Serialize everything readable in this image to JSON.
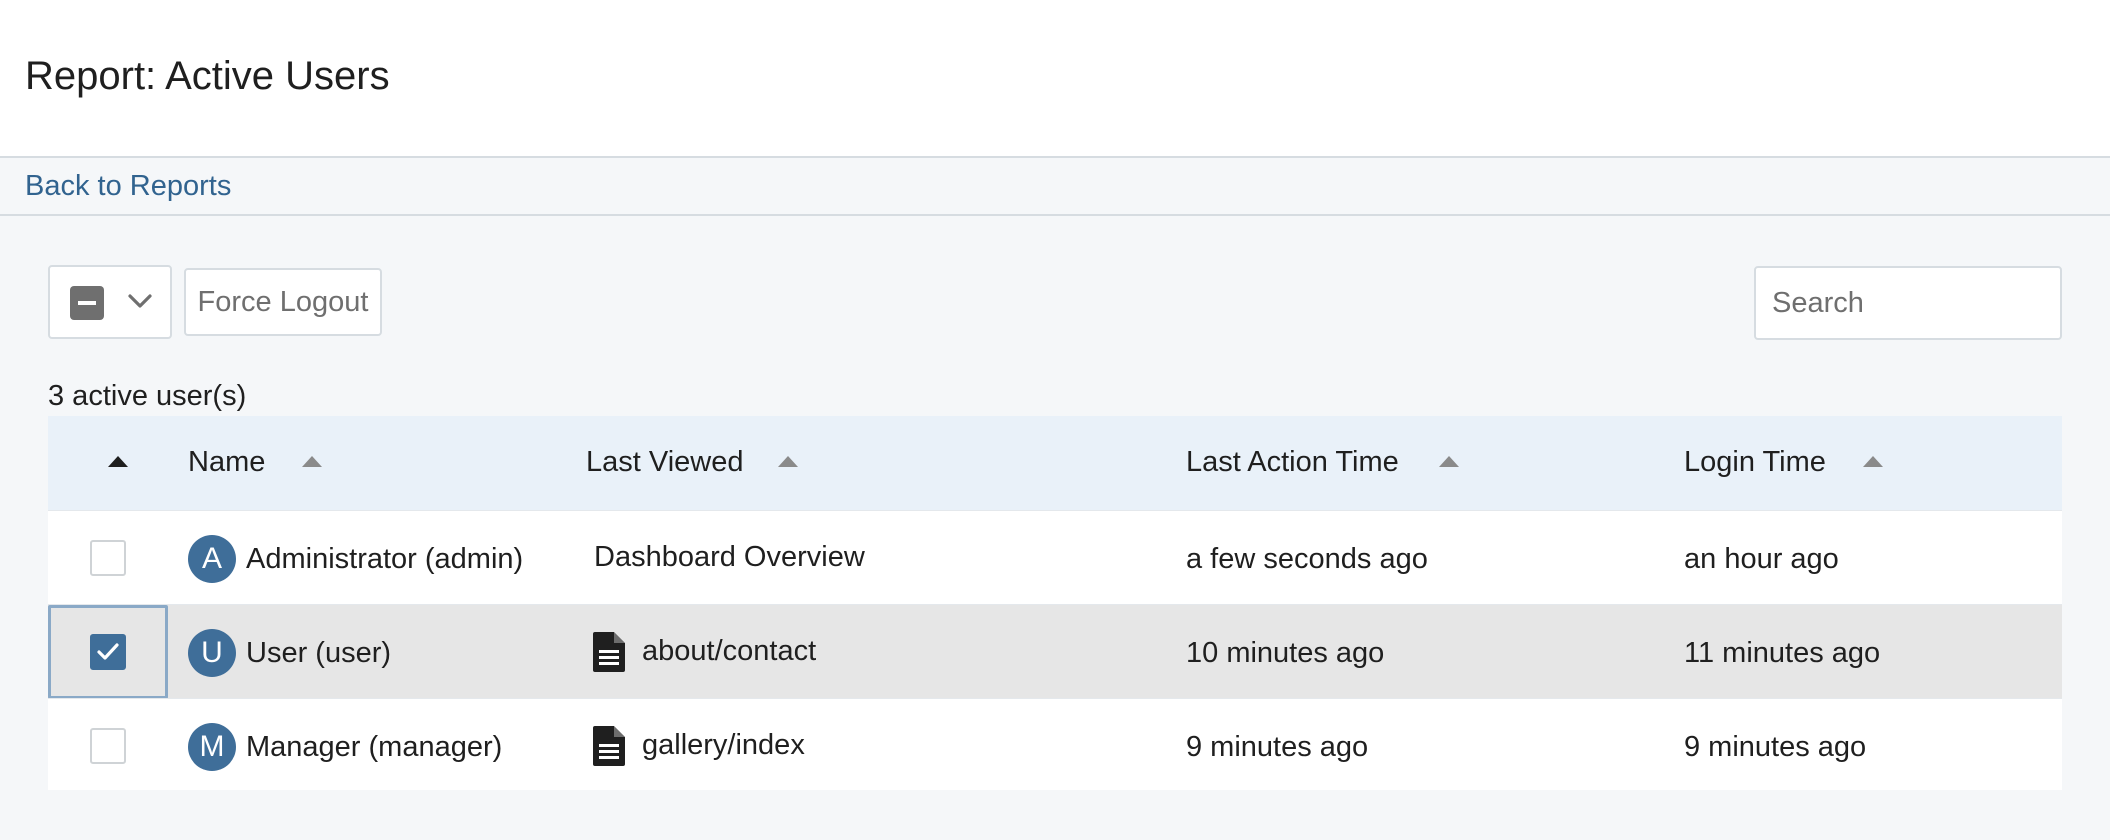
{
  "header": {
    "title": "Report: Active Users"
  },
  "breadcrumb": {
    "back_label": "Back to Reports"
  },
  "toolbar": {
    "force_logout_label": "Force Logout",
    "search_placeholder": "Search"
  },
  "summary": {
    "count_text": "3 active user(s)"
  },
  "table": {
    "columns": [
      "Name",
      "Last Viewed",
      "Last Action Time",
      "Login Time"
    ],
    "rows": [
      {
        "initial": "A",
        "name": "Administrator (admin)",
        "last_viewed": "Dashboard Overview",
        "last_viewed_icon": "",
        "last_action": "a few seconds ago",
        "login": "an hour ago",
        "selected": false
      },
      {
        "initial": "U",
        "name": "User (user)",
        "last_viewed": "about/contact",
        "last_viewed_icon": "document-icon",
        "last_action": "10 minutes ago",
        "login": "11 minutes ago",
        "selected": true
      },
      {
        "initial": "M",
        "name": "Manager (manager)",
        "last_viewed": "gallery/index",
        "last_viewed_icon": "document-icon",
        "last_action": "9 minutes ago",
        "login": "9 minutes ago",
        "selected": false
      }
    ]
  },
  "colors": {
    "accent": "#3f6e99",
    "link": "#31638f",
    "header_row_bg": "#e9f1f9",
    "selected_row_bg": "#e6e6e6"
  }
}
